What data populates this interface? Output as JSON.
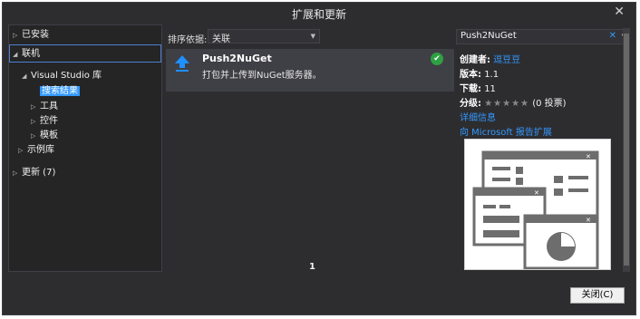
{
  "window": {
    "title": "扩展和更新",
    "close": "✕"
  },
  "tree": {
    "installed": "已安装",
    "online": "联机",
    "vs_lib": "Visual Studio 库",
    "search_results": "搜索结果",
    "tools": "工具",
    "controls": "控件",
    "templates": "模板",
    "samples": "示例库",
    "updates": "更新 (7)"
  },
  "middle": {
    "sort_label": "排序依据:",
    "sort_value": "关联",
    "item": {
      "name": "Push2NuGet",
      "desc": "打包并上传到NuGet服务器。"
    },
    "page": "1"
  },
  "right": {
    "search_value": "Push2NuGet",
    "details": {
      "creator_label": "创建者:",
      "creator_value": "逗豆豆",
      "version_label": "版本:",
      "version_value": "1.1",
      "downloads_label": "下载:",
      "downloads_value": "11",
      "rating_label": "分级:",
      "rating_stars": "★★★★★",
      "rating_votes": "(0 投票)",
      "more_info": "详细信息",
      "report": "向 Microsoft 报告扩展"
    }
  },
  "footer": {
    "close_button": "关闭(C)"
  }
}
